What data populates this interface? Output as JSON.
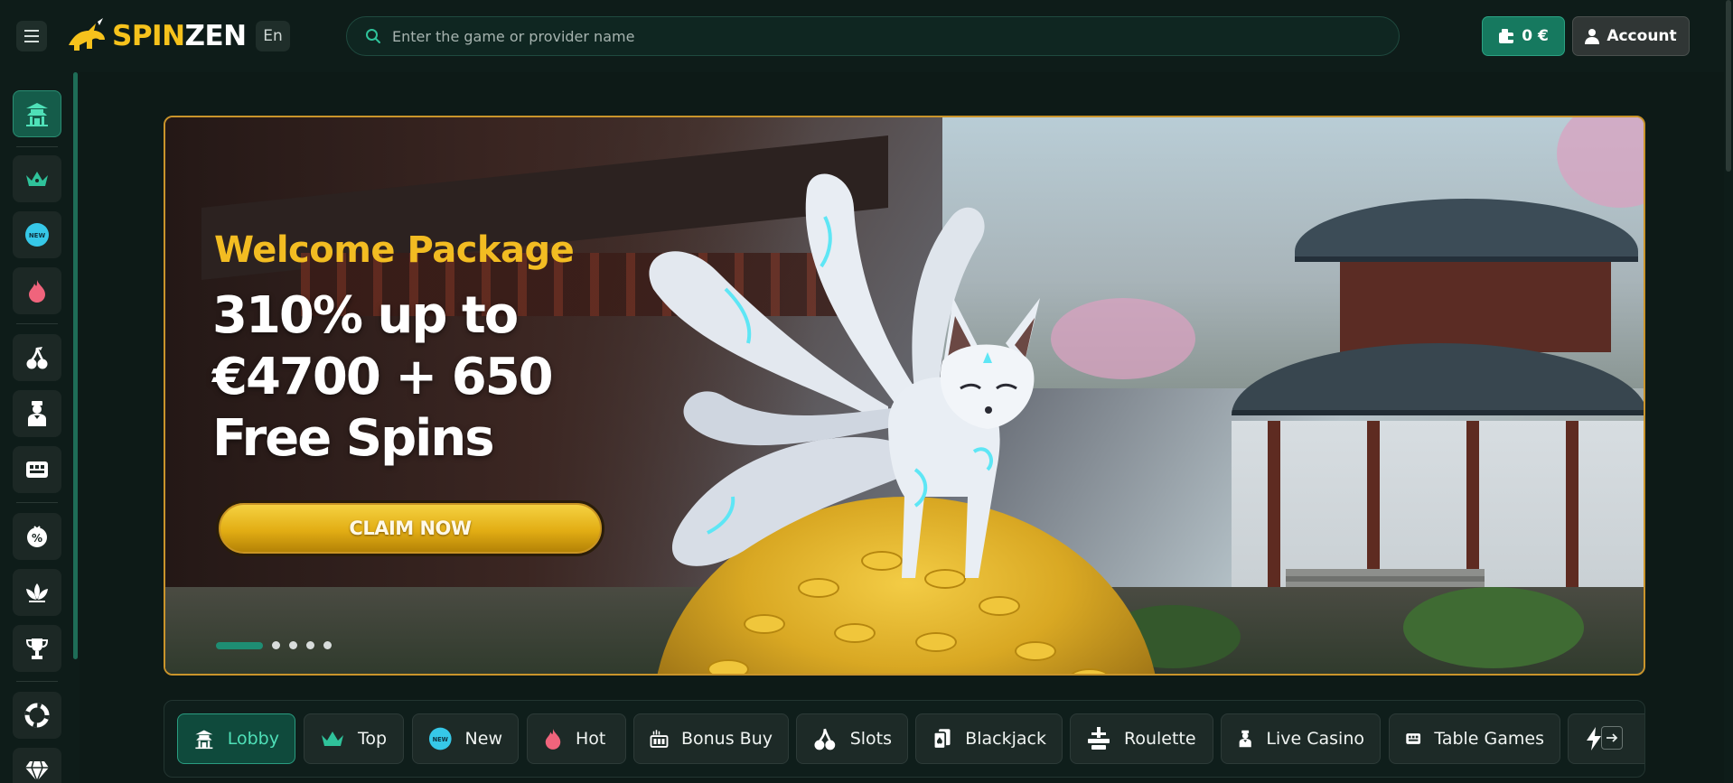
{
  "header": {
    "menu_icon": "hamburger-menu-icon",
    "logo": {
      "part1": "SPIN",
      "part2": "ZEN",
      "colors": {
        "spin": "#f6c21c",
        "zen": "#ffffff"
      }
    },
    "language": "En",
    "search": {
      "placeholder": "Enter the game or provider name",
      "icon": "search-icon"
    },
    "wallet": {
      "label": "0 €",
      "icon": "wallet-icon"
    },
    "account": {
      "label": "Account",
      "icon": "user-icon"
    }
  },
  "sidebar": {
    "items": [
      {
        "name": "lobby",
        "icon": "pagoda-icon",
        "active": true
      },
      {
        "name": "top",
        "icon": "crown-icon"
      },
      {
        "name": "new",
        "icon": "new-badge-icon"
      },
      {
        "name": "hot",
        "icon": "flame-icon"
      },
      {
        "name": "slots",
        "icon": "cherries-icon"
      },
      {
        "name": "live-casino",
        "icon": "dealer-icon"
      },
      {
        "name": "table-games",
        "icon": "table-icon"
      },
      {
        "name": "promotions",
        "icon": "percent-badge-icon"
      },
      {
        "name": "zen",
        "icon": "lotus-icon"
      },
      {
        "name": "tournaments",
        "icon": "trophy-icon"
      },
      {
        "name": "support",
        "icon": "lifebuoy-icon"
      },
      {
        "name": "vip",
        "icon": "diamond-icon"
      }
    ]
  },
  "banner": {
    "welcome": "Welcome Package",
    "headline_line1": "310% up to",
    "headline_line2": "€4700 + 650",
    "headline_line3": "Free Spins",
    "cta": "CLAIM NOW",
    "slides_total": 5,
    "active_slide": 1,
    "colors": {
      "border": "#c9942b",
      "welcome": "#f2bc22",
      "cta": "#e2ad14"
    }
  },
  "categories": {
    "items": [
      {
        "label": "Lobby",
        "icon": "pagoda-icon",
        "active": true
      },
      {
        "label": "Top",
        "icon": "crown-icon"
      },
      {
        "label": "New",
        "icon": "new-badge-icon"
      },
      {
        "label": "Hot",
        "icon": "flame-icon"
      },
      {
        "label": "Bonus Buy",
        "icon": "bonus-buy-icon"
      },
      {
        "label": "Slots",
        "icon": "cherries-icon"
      },
      {
        "label": "Blackjack",
        "icon": "cards-icon"
      },
      {
        "label": "Roulette",
        "icon": "roulette-icon"
      },
      {
        "label": "Live Casino",
        "icon": "dealer-icon"
      },
      {
        "label": "Table Games",
        "icon": "table-icon"
      }
    ],
    "next_arrow": "arrow-right-icon",
    "accent": "#4fe0b8"
  }
}
